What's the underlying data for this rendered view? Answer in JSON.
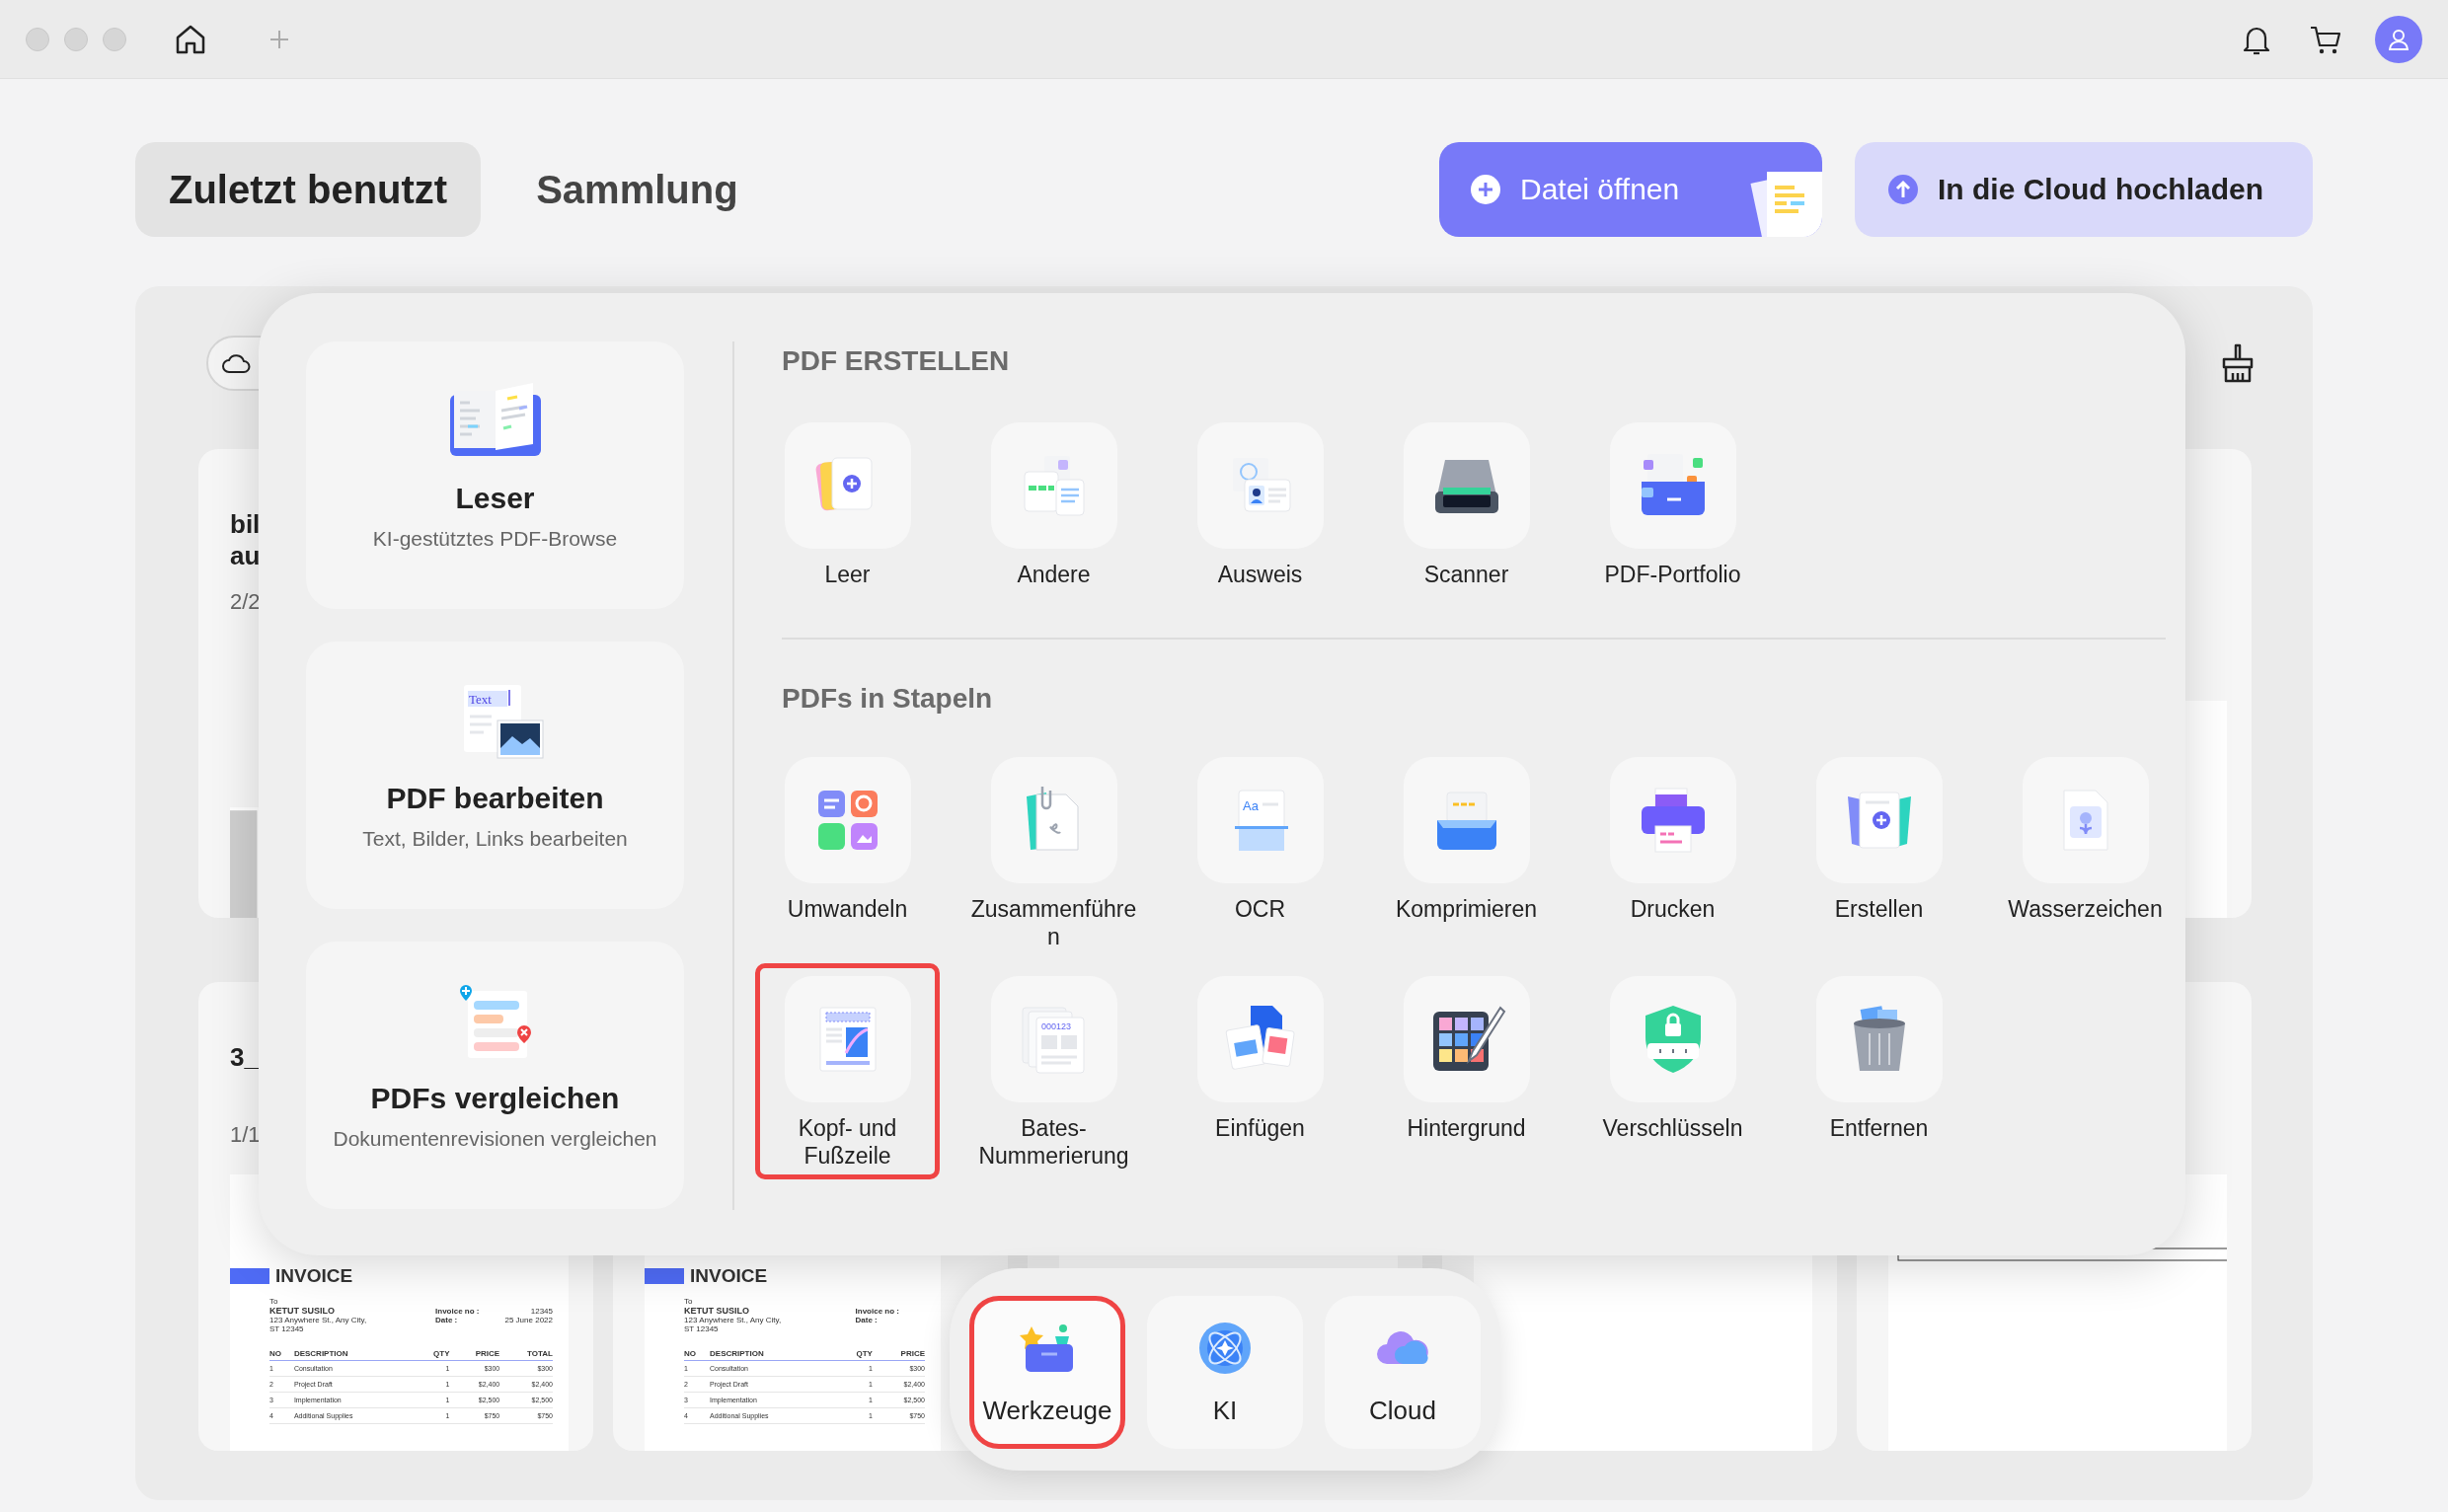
{
  "tabs": [
    {
      "label": "Zuletzt benutzt",
      "selected": true
    },
    {
      "label": "Sammlung",
      "selected": false
    }
  ],
  "actions": [
    {
      "label": "Datei öffnen",
      "kind": "primary"
    },
    {
      "label": "In die Cloud hochladen",
      "kind": "secondary"
    }
  ],
  "recent_files": [
    {
      "title_lines": [
        "bil",
        "au"
      ],
      "pages": "2/2"
    },
    {
      "title_lines": [
        "3_"
      ],
      "pages": "1/1"
    }
  ],
  "invoices": [
    {
      "heading": "INVOICE",
      "to_label": "To",
      "name": "KETUT SUSILO",
      "address": [
        "123 Anywhere St., Any City,",
        "ST 12345"
      ],
      "meta": [
        {
          "label": "Invoice no :",
          "value": "12345"
        },
        {
          "label": "Date :",
          "value": "25 June 2022"
        }
      ],
      "columns": [
        "NO",
        "DESCRIPTION",
        "QTY",
        "PRICE",
        "TOTAL"
      ],
      "rows": [
        [
          "1",
          "Consultation",
          "1",
          "$300",
          "$300"
        ],
        [
          "2",
          "Project Draft",
          "1",
          "$2,400",
          "$2,400"
        ],
        [
          "3",
          "Implementation",
          "1",
          "$2,500",
          "$2,500"
        ],
        [
          "4",
          "Additional Supplies",
          "1",
          "$750",
          "$750"
        ]
      ]
    },
    {
      "heading": "INVOICE",
      "to_label": "To",
      "name": "KETUT SUSILO",
      "address": [
        "123 Anywhere St., Any City,",
        "ST 12345"
      ],
      "meta": [
        {
          "label": "Invoice no :"
        },
        {
          "label": "Date :"
        }
      ],
      "columns": [
        "NO",
        "DESCRIPTION",
        "QTY",
        "PRICE"
      ],
      "rows": [
        [
          "1",
          "Consultation",
          "1",
          "$300"
        ],
        [
          "2",
          "Project Draft",
          "1",
          "$2,400"
        ],
        [
          "3",
          "Implementation",
          "1",
          "$2,500"
        ],
        [
          "4",
          "Additional Supplies",
          "1",
          "$750"
        ]
      ]
    }
  ],
  "tools_menu": {
    "features": [
      {
        "title": "Leser",
        "subtitle": "KI-gestütztes PDF-Browse"
      },
      {
        "title": "PDF bearbeiten",
        "subtitle": "Text, Bilder, Links bearbeiten",
        "icon_text": "Text"
      },
      {
        "title": "PDFs vergleichen",
        "subtitle": "Dokumentenrevisionen vergleichen"
      }
    ],
    "sections": [
      {
        "heading": "PDF ERSTELLEN",
        "items": [
          {
            "label": "Leer",
            "highlighted": false
          },
          {
            "label": "Andere",
            "highlighted": false
          },
          {
            "label": "Ausweis",
            "highlighted": false
          },
          {
            "label": "Scanner",
            "highlighted": false
          },
          {
            "label": "PDF-Portfolio",
            "highlighted": false
          }
        ]
      },
      {
        "heading": "PDFs in Stapeln",
        "items": [
          {
            "label": "Umwandeln",
            "highlighted": false
          },
          {
            "label": "Zusammenführen",
            "highlighted": false
          },
          {
            "label": "OCR",
            "highlighted": false,
            "icon_text": "Aa"
          },
          {
            "label": "Komprimieren",
            "highlighted": false
          },
          {
            "label": "Drucken",
            "highlighted": false
          },
          {
            "label": "Erstellen",
            "highlighted": false
          },
          {
            "label": "Wasserzeichen",
            "highlighted": false
          },
          {
            "label": "Kopf- und Fußzeile",
            "highlighted": true
          },
          {
            "label": "Bates-Nummerierung",
            "highlighted": false,
            "icon_text": "000123"
          },
          {
            "label": "Einfügen",
            "highlighted": false
          },
          {
            "label": "Hintergrund",
            "highlighted": false
          },
          {
            "label": "Verschlüsseln",
            "highlighted": false
          },
          {
            "label": "Entfernen",
            "highlighted": false
          }
        ]
      }
    ]
  },
  "dock": [
    {
      "label": "Werkzeuge",
      "highlighted": true
    },
    {
      "label": "KI",
      "highlighted": false
    },
    {
      "label": "Cloud",
      "highlighted": false
    }
  ]
}
